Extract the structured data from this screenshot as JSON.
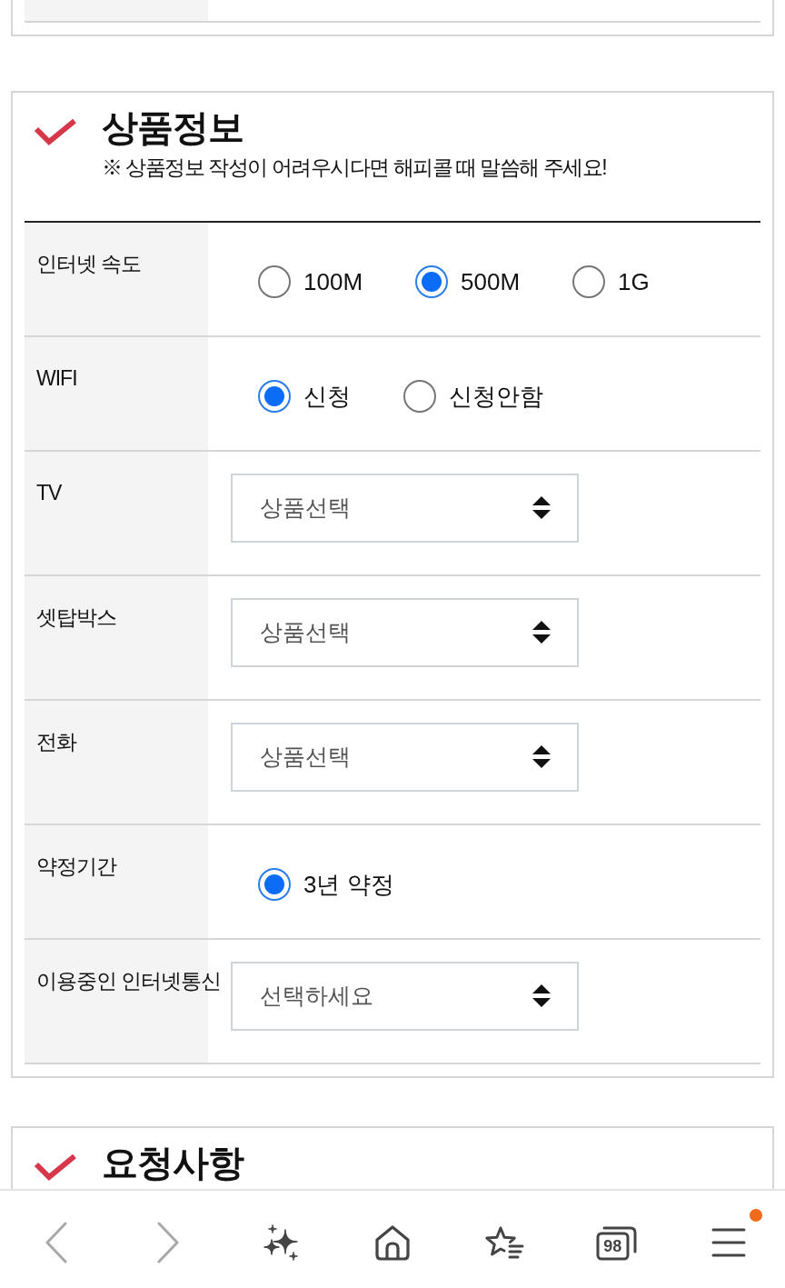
{
  "sections": [
    {
      "title": "상품정보",
      "note": "※ 상품정보 작성이 어려우시다면 해피콜 때 말씀해 주세요!",
      "fields": [
        {
          "label": "인터넷 속도",
          "kind": "radio",
          "options": [
            {
              "label": "100M",
              "selected": false
            },
            {
              "label": "500M",
              "selected": true
            },
            {
              "label": "1G",
              "selected": false
            }
          ]
        },
        {
          "label": "WIFI",
          "kind": "radio",
          "options": [
            {
              "label": "신청",
              "selected": true
            },
            {
              "label": "신청안함",
              "selected": false
            }
          ]
        },
        {
          "label": "TV",
          "kind": "select",
          "value": "상품선택"
        },
        {
          "label": "셋탑박스",
          "kind": "select",
          "value": "상품선택"
        },
        {
          "label": "전화",
          "kind": "select",
          "value": "상품선택"
        },
        {
          "label": "약정기간",
          "kind": "radio",
          "options": [
            {
              "label": "3년 약정",
              "selected": true
            }
          ]
        },
        {
          "label": "이용중인 인터넷통신",
          "kind": "select",
          "value": "선택하세요"
        }
      ]
    },
    {
      "title": "요청사항"
    }
  ],
  "toolbar": [
    {
      "kind": "back",
      "disabled": true,
      "notification": false
    },
    {
      "kind": "forward",
      "disabled": true,
      "notification": false
    },
    {
      "kind": "assistant",
      "disabled": false,
      "notification": false
    },
    {
      "kind": "home",
      "disabled": false,
      "notification": false
    },
    {
      "kind": "bookmarks",
      "disabled": false,
      "notification": false
    },
    {
      "kind": "tabs",
      "count": "98",
      "disabled": false,
      "notification": false
    },
    {
      "kind": "menu",
      "disabled": false,
      "notification": true
    }
  ]
}
